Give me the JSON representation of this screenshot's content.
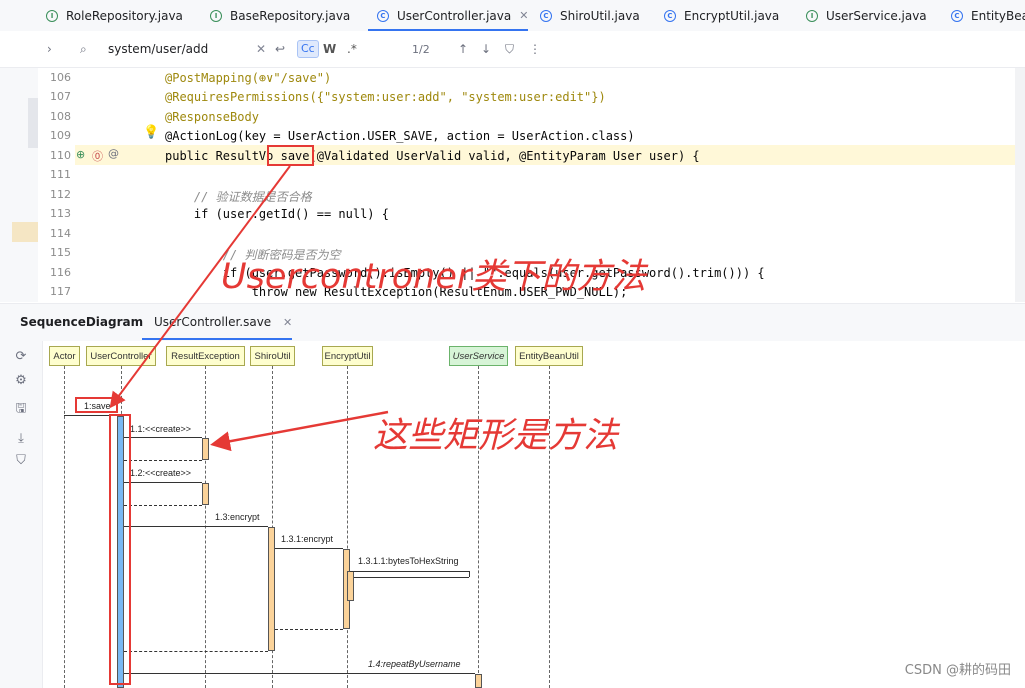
{
  "tabs": [
    {
      "label": "RoleRepository.java",
      "icon": "interface-icon"
    },
    {
      "label": "BaseRepository.java",
      "icon": "interface-icon"
    },
    {
      "label": "UserController.java",
      "icon": "class-icon",
      "active": true
    },
    {
      "label": "ShiroUtil.java",
      "icon": "class-icon"
    },
    {
      "label": "EncryptUtil.java",
      "icon": "class-icon"
    },
    {
      "label": "UserService.java",
      "icon": "interface-icon"
    },
    {
      "label": "EntityBea",
      "icon": "class-icon"
    }
  ],
  "search": {
    "value": "system/user/add",
    "match_count": "1/2",
    "case_label": "Cc",
    "word_label": "W",
    "regex_label": ".*"
  },
  "code_lines": [
    {
      "num": "106",
      "text": "@PostMapping(⊕∨\"/save\")"
    },
    {
      "num": "107",
      "text": "@RequiresPermissions({\"system:user:add\", \"system:user:edit\"})"
    },
    {
      "num": "108",
      "text": "@ResponseBody"
    },
    {
      "num": "109",
      "text": "@ActionLog(key = UserAction.USER_SAVE, action = UserAction.class)"
    },
    {
      "num": "110",
      "text": "public ResultVo save(@Validated UserValid valid, @EntityParam User user) {"
    },
    {
      "num": "111",
      "text": ""
    },
    {
      "num": "112",
      "text": "    // 验证数据是否合格"
    },
    {
      "num": "113",
      "text": "    if (user.getId() == null) {"
    },
    {
      "num": "114",
      "text": ""
    },
    {
      "num": "115",
      "text": "        // 判断密码是否为空"
    },
    {
      "num": "116",
      "text": "        if (user.getPassword().isEmpty() || \"\".equals(user.getPassword().trim())) {"
    },
    {
      "num": "117",
      "text": "            throw new ResultException(ResultEnum.USER_PWD_NULL);"
    }
  ],
  "sequence": {
    "panel_title": "SequenceDiagram",
    "tab_label": "UserController.save",
    "lifelines": [
      "Actor",
      "UserController",
      "ResultException",
      "ShiroUtil",
      "EncryptUtil",
      "UserService",
      "EntityBeanUtil"
    ],
    "messages": [
      "1:save",
      "1.1:<<create>>",
      "1.2:<<create>>",
      "1.3:encrypt",
      "1.3.1:encrypt",
      "1.3.1.1:bytesToHexString",
      "1.4:repeatByUsername"
    ]
  },
  "annotations": {
    "class_method_note": "Usercontroner类下的方法",
    "rect_note": "这些矩形是方法"
  },
  "watermark": "CSDN @耕的码田",
  "colors": {
    "accent": "#3574f0",
    "annotation_red": "#e53935",
    "activation_orange": "#fbd39a",
    "activation_blue": "#7ab8f2",
    "lifeline_box": "#fefece",
    "service_box": "#d7f4d7"
  }
}
